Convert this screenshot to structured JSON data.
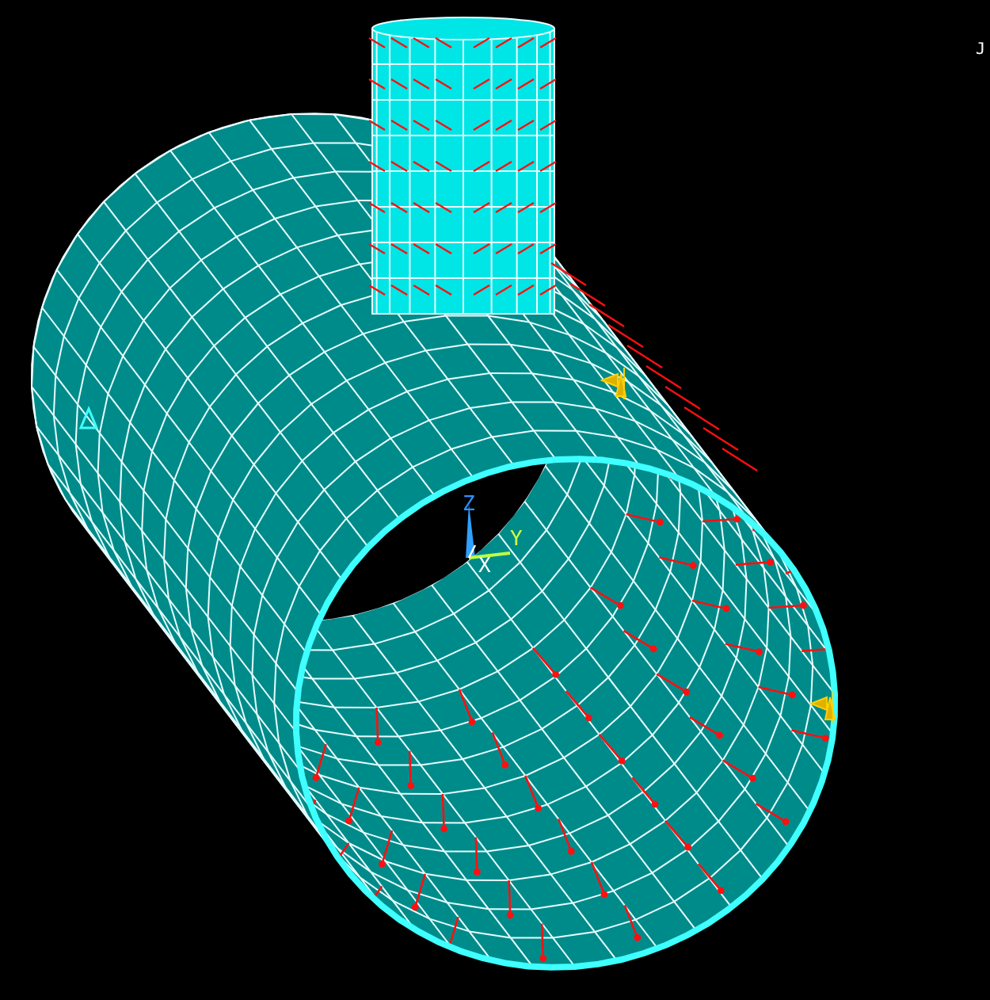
{
  "corner_label": "J",
  "triad": {
    "labels": [
      "Z",
      "Y",
      "X"
    ]
  }
}
